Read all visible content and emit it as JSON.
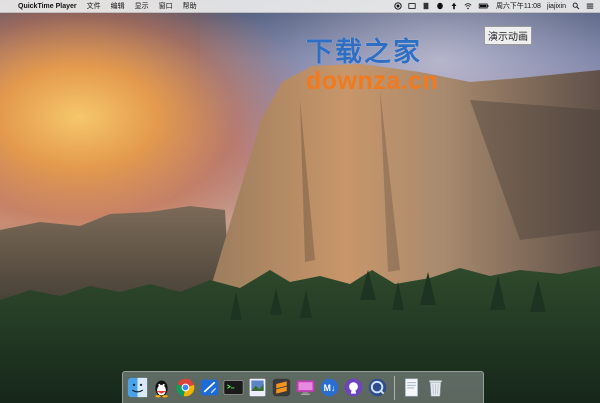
{
  "menubar": {
    "apple_glyph": "",
    "app_name": "QuickTime Player",
    "menus": [
      "文件",
      "编辑",
      "显示",
      "窗口",
      "帮助"
    ],
    "clock": "周六下午11:08",
    "user": "jiajixin"
  },
  "watermark": {
    "chinese": "下载之家",
    "english": "downza.cn"
  },
  "demo_label": "演示动画",
  "dock": {
    "apps": [
      "finder-icon",
      "qq-icon",
      "chrome-icon",
      "xcode-icon",
      "terminal-icon",
      "preview-icon",
      "sublime-text-icon",
      "monitor-icon",
      "markdown-icon",
      "github-icon",
      "quicktime-icon"
    ],
    "stack": [
      "documents-icon",
      "trash-icon"
    ]
  },
  "colors": {
    "watermark_blue": "#2e6fc4",
    "watermark_orange": "#f07a1d"
  }
}
